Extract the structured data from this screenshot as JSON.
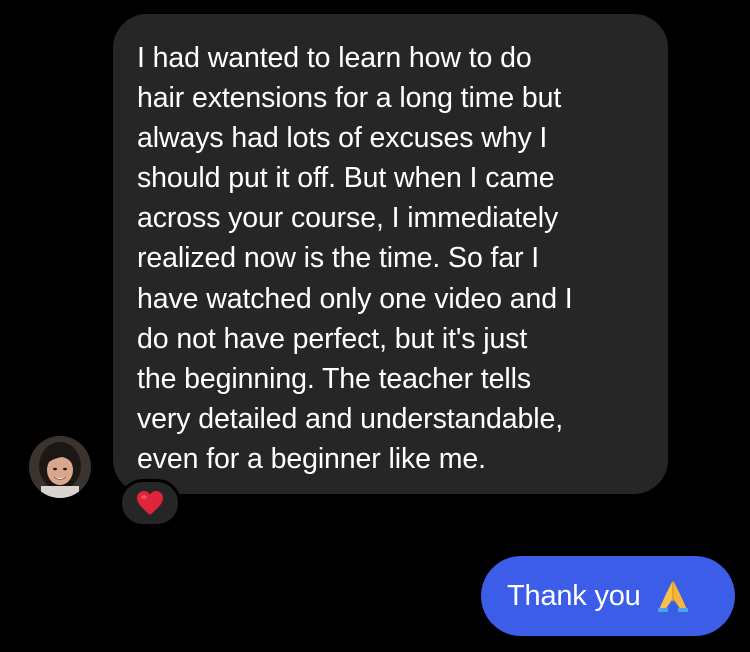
{
  "thread": {
    "incoming_message": {
      "lines": [
        "I had wanted to learn how to do",
        "hair extensions for a long time but",
        "always had lots of excuses why I",
        "should put it off. But when I came",
        "across your course, I immediately",
        "realized now is the time. So far I",
        "have watched only one video and I",
        "do not have perfect, but it's just",
        "the beginning. The teacher tells",
        "very detailed and understandable,",
        "even for a beginner like me."
      ],
      "reaction_icon": "red-heart",
      "avatar_icon": "profile-photo"
    },
    "outgoing_message": {
      "text": "Thank you",
      "emoji_icon": "folded-hands"
    }
  },
  "colors": {
    "background": "#000000",
    "incoming_bubble": "#262626",
    "outgoing_bubble": "#3b5de8",
    "text": "#ffffff",
    "heart": "#e0243a"
  }
}
